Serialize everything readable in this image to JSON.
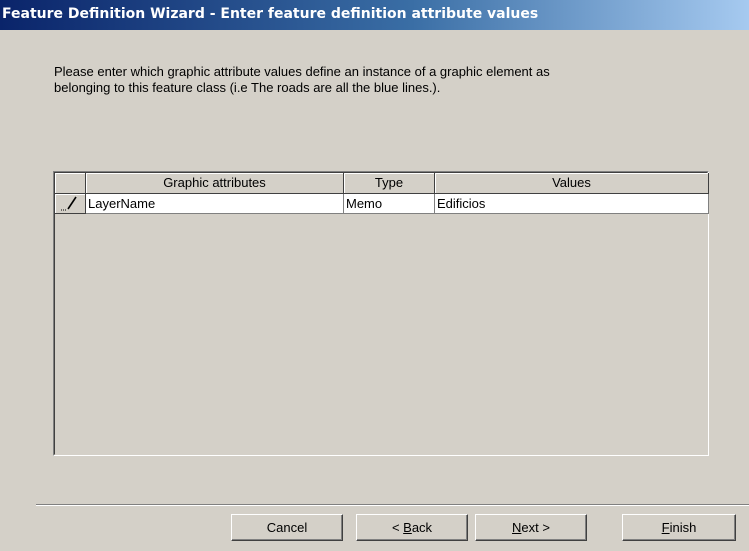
{
  "window": {
    "title": "Feature Definition Wizard - Enter feature definition attribute values"
  },
  "instructions": {
    "line1": "Please enter which graphic attribute values define an instance of a graphic element as",
    "line2": "belonging to this feature class (i.e The roads are all the blue lines.)."
  },
  "grid": {
    "columns": [
      "Graphic attributes",
      "Type",
      "Values"
    ],
    "rows": [
      {
        "indicator": "edit-pencil-icon",
        "attribute": "LayerName",
        "type": "Memo",
        "value": "Edificios"
      }
    ]
  },
  "buttons": {
    "cancel": "Cancel",
    "back_prefix": "< ",
    "back_accel": "B",
    "back_rest": "ack",
    "next_accel": "N",
    "next_rest": "ext >",
    "finish_accel": "F",
    "finish_rest": "inish"
  },
  "colors": {
    "dialog_face": "#d4d0c8",
    "titlebar_start": "#0a246a",
    "titlebar_end": "#a6caf0"
  }
}
